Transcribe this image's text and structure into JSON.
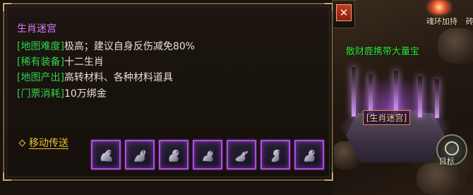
{
  "world": {
    "broadcast_message": "散财鹿携带大量宝",
    "dungeon_label": "[生肖迷宫]",
    "buff_label": "魂环加持",
    "buff_label_clipped": "砖",
    "target_label": "目标"
  },
  "panel": {
    "title": "生肖迷宫",
    "lines": [
      {
        "tag": "[地图难度]",
        "value": "极高；建议自身反伤减免80%"
      },
      {
        "tag": "[稀有装备]",
        "value": "十二生肖"
      },
      {
        "tag": "[地图产出]",
        "value": "高转材料、各种材料道具"
      },
      {
        "tag": "[门票消耗]",
        "value": "10万绑金"
      }
    ],
    "teleport_label": "移动传送",
    "close_label": "✕",
    "items": [
      {
        "icon": "zodiac-figurine-1-icon"
      },
      {
        "icon": "zodiac-figurine-2-icon"
      },
      {
        "icon": "zodiac-figurine-3-icon"
      },
      {
        "icon": "zodiac-figurine-4-icon"
      },
      {
        "icon": "zodiac-dragon-icon"
      },
      {
        "icon": "zodiac-snake-icon"
      },
      {
        "icon": "zodiac-figurine-7-icon"
      }
    ]
  },
  "colors": {
    "title": "#e07aff",
    "tag": "#2fd44c",
    "value": "#e8e0cc",
    "teleport": "#f0c030",
    "item_border": "#b04ce0",
    "broadcast": "#38e838"
  }
}
